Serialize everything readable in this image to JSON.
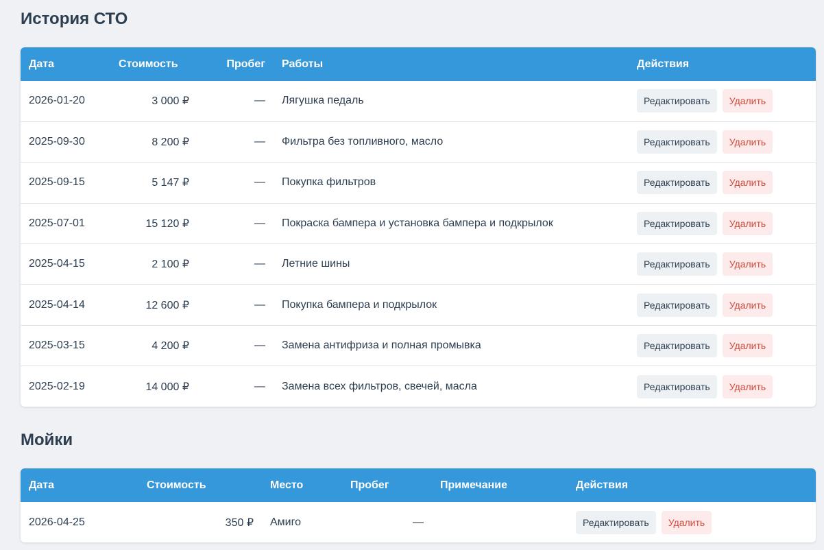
{
  "sto": {
    "title": "История СТО",
    "headers": {
      "date": "Дата",
      "cost": "Стоимость",
      "mileage": "Пробег",
      "works": "Работы",
      "actions": "Действия"
    },
    "rows": [
      {
        "date": "2026-01-20",
        "cost": "3 000 ₽",
        "mileage": "—",
        "works": "Лягушка педаль"
      },
      {
        "date": "2025-09-30",
        "cost": "8 200 ₽",
        "mileage": "—",
        "works": "Фильтра без топливного, масло"
      },
      {
        "date": "2025-09-15",
        "cost": "5 147 ₽",
        "mileage": "—",
        "works": "Покупка фильтров"
      },
      {
        "date": "2025-07-01",
        "cost": "15 120 ₽",
        "mileage": "—",
        "works": "Покраска бампера и установка бампера и подкрылок"
      },
      {
        "date": "2025-04-15",
        "cost": "2 100 ₽",
        "mileage": "—",
        "works": "Летние шины"
      },
      {
        "date": "2025-04-14",
        "cost": "12 600 ₽",
        "mileage": "—",
        "works": "Покупка бампера и подкрылок"
      },
      {
        "date": "2025-03-15",
        "cost": "4 200 ₽",
        "mileage": "—",
        "works": "Замена антифриза и полная промывка"
      },
      {
        "date": "2025-02-19",
        "cost": "14 000 ₽",
        "mileage": "—",
        "works": "Замена всех фильтров, свечей, масла"
      }
    ]
  },
  "wash": {
    "title": "Мойки",
    "headers": {
      "date": "Дата",
      "cost": "Стоимость",
      "place": "Место",
      "mileage": "Пробег",
      "note": "Примечание",
      "actions": "Действия"
    },
    "rows": [
      {
        "date": "2026-04-25",
        "cost": "350 ₽",
        "place": "Амиго",
        "mileage": "—",
        "note": ""
      }
    ]
  },
  "actions": {
    "edit_label": "Редактировать",
    "delete_label": "Удалить"
  },
  "colors": {
    "header_bg": "#3498db",
    "page_bg": "#eff1f5",
    "edit_bg": "#eef1f4",
    "delete_bg": "#fdeaea",
    "delete_text": "#d24a3c"
  }
}
